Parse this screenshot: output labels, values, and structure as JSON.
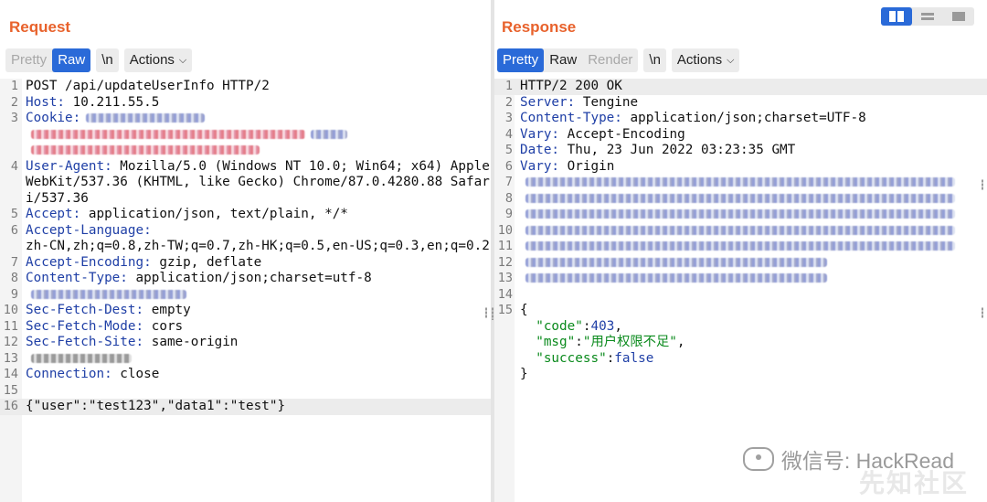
{
  "request": {
    "title": "Request",
    "tabs": {
      "pretty": "Pretty",
      "raw": "Raw",
      "newline": "\\n",
      "actions": "Actions"
    },
    "lines": [
      {
        "n": "1",
        "parts": [
          {
            "t": "POST /api/updateUserInfo HTTP/2"
          }
        ]
      },
      {
        "n": "2",
        "parts": [
          {
            "k": "Host:"
          },
          {
            "t": " 10.211.55.5"
          }
        ]
      },
      {
        "n": "3",
        "parts": [
          {
            "k": "Cookie:"
          }
        ],
        "redacted": "cookie"
      },
      {
        "n": "4",
        "parts": [
          {
            "k": "User-Agent:"
          },
          {
            "t": " Mozilla/5.0 (Windows NT 10.0; Win64; x64) AppleWebKit/537.36 (KHTML, like Gecko) Chrome/87.0.4280.88 Safari/537.36"
          }
        ]
      },
      {
        "n": "5",
        "parts": [
          {
            "k": "Accept:"
          },
          {
            "t": " application/json, text/plain, */*"
          }
        ]
      },
      {
        "n": "6",
        "parts": [
          {
            "k": "Accept-Language:"
          },
          {
            "t": "\nzh-CN,zh;q=0.8,zh-TW;q=0.7,zh-HK;q=0.5,en-US;q=0.3,en;q=0.2"
          }
        ]
      },
      {
        "n": "7",
        "parts": [
          {
            "k": "Accept-Encoding:"
          },
          {
            "t": " gzip, deflate"
          }
        ]
      },
      {
        "n": "8",
        "parts": [
          {
            "k": "Content-Type:"
          },
          {
            "t": " application/json;charset=utf-8"
          }
        ]
      },
      {
        "n": "9",
        "parts": [],
        "redacted": "short"
      },
      {
        "n": "10",
        "parts": [
          {
            "k": "Sec-Fetch-Dest:"
          },
          {
            "t": " empty"
          }
        ]
      },
      {
        "n": "11",
        "parts": [
          {
            "k": "Sec-Fetch-Mode:"
          },
          {
            "t": " cors"
          }
        ]
      },
      {
        "n": "12",
        "parts": [
          {
            "k": "Sec-Fetch-Site:"
          },
          {
            "t": " same-origin"
          }
        ]
      },
      {
        "n": "13",
        "parts": [],
        "redacted": "tiny"
      },
      {
        "n": "14",
        "parts": [
          {
            "k": "Connection:"
          },
          {
            "t": " close"
          }
        ]
      },
      {
        "n": "15",
        "parts": [
          {
            "t": ""
          }
        ]
      },
      {
        "n": "16",
        "parts": [
          {
            "t": "{\"user\":\"test123\",\"data1\":\"test\"}"
          }
        ],
        "highlight": true
      }
    ]
  },
  "response": {
    "title": "Response",
    "tabs": {
      "pretty": "Pretty",
      "raw": "Raw",
      "render": "Render",
      "newline": "\\n",
      "actions": "Actions"
    },
    "lines": [
      {
        "n": "1",
        "parts": [
          {
            "t": "HTTP/2 200 OK"
          }
        ],
        "highlight": true
      },
      {
        "n": "2",
        "parts": [
          {
            "k": "Server:"
          },
          {
            "t": " Tengine"
          }
        ]
      },
      {
        "n": "3",
        "parts": [
          {
            "k": "Content-Type:"
          },
          {
            "t": " application/json;charset=UTF-8"
          }
        ]
      },
      {
        "n": "4",
        "parts": [
          {
            "k": "Vary:"
          },
          {
            "t": " Accept-Encoding"
          }
        ]
      },
      {
        "n": "5",
        "parts": [
          {
            "k": "Date:"
          },
          {
            "t": " Thu, 23 Jun 2022 03:23:35 GMT"
          }
        ]
      },
      {
        "n": "6",
        "parts": [
          {
            "k": "Vary:"
          },
          {
            "t": " Origin"
          }
        ]
      },
      {
        "n": "7",
        "parts": [],
        "redacted": "long"
      },
      {
        "n": "8",
        "parts": [],
        "redacted": "long"
      },
      {
        "n": "9",
        "parts": [],
        "redacted": "long"
      },
      {
        "n": "10",
        "parts": [],
        "redacted": "long"
      },
      {
        "n": "11",
        "parts": [],
        "redacted": "long"
      },
      {
        "n": "12",
        "parts": [],
        "redacted": "medium"
      },
      {
        "n": "13",
        "parts": [],
        "redacted": "medium"
      },
      {
        "n": "14",
        "parts": [
          {
            "t": ""
          }
        ]
      },
      {
        "n": "15",
        "parts": [
          {
            "t": "{"
          }
        ]
      },
      {
        "n": "",
        "parts": [
          {
            "t": "  "
          },
          {
            "s": "\"code\""
          },
          {
            "t": ":"
          },
          {
            "kw": "403"
          },
          {
            "t": ","
          }
        ]
      },
      {
        "n": "",
        "parts": [
          {
            "t": "  "
          },
          {
            "s": "\"msg\""
          },
          {
            "t": ":"
          },
          {
            "s": "\"用户权限不足\""
          },
          {
            "t": ","
          }
        ]
      },
      {
        "n": "",
        "parts": [
          {
            "t": "  "
          },
          {
            "s": "\"success\""
          },
          {
            "t": ":"
          },
          {
            "kw": "false"
          }
        ]
      },
      {
        "n": "",
        "parts": [
          {
            "t": "}"
          }
        ]
      }
    ]
  },
  "watermark": {
    "text": "微信号: HackRead",
    "text2": "先知社区"
  }
}
